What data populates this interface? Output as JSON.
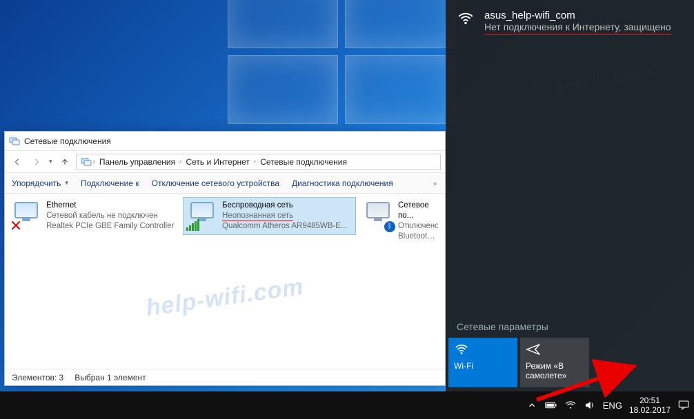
{
  "explorer": {
    "title": "Сетевые подключения",
    "breadcrumb": [
      "Панель управления",
      "Сеть и Интернет",
      "Сетевые подключения"
    ],
    "toolbar": {
      "organize": "Упорядочить",
      "connect": "Подключение к",
      "disable": "Отключение сетевого устройства",
      "diagnose": "Диагностика подключения"
    },
    "connections": [
      {
        "name": "Ethernet",
        "status": "Сетевой кабель не подключен",
        "device": "Realtek PCIe GBE Family Controller",
        "kind": "ethernet-unplugged"
      },
      {
        "name": "Беспроводная сеть",
        "status": "Неопознанная сеть",
        "device": "Qualcomm Atheros AR9485WB-E...",
        "kind": "wifi",
        "selected": true,
        "annotated": true
      },
      {
        "name": "Сетевое по...",
        "status": "Отключено",
        "device": "Bluetooth D...",
        "kind": "bluetooth"
      }
    ],
    "statusbar": {
      "count_label": "Элементов: 3",
      "selected_label": "Выбран 1 элемент"
    }
  },
  "flyout": {
    "network": {
      "ssid": "asus_help-wifi_com",
      "status": "Нет подключения к Интернету, защищено"
    },
    "settings_link": "Сетевые параметры",
    "tiles": {
      "wifi": "Wi-Fi",
      "airplane": "Режим «В самолете»"
    }
  },
  "taskbar": {
    "lang": "ENG",
    "time": "20:51",
    "date": "18.02.2017"
  },
  "watermark": "help-wifi.com"
}
